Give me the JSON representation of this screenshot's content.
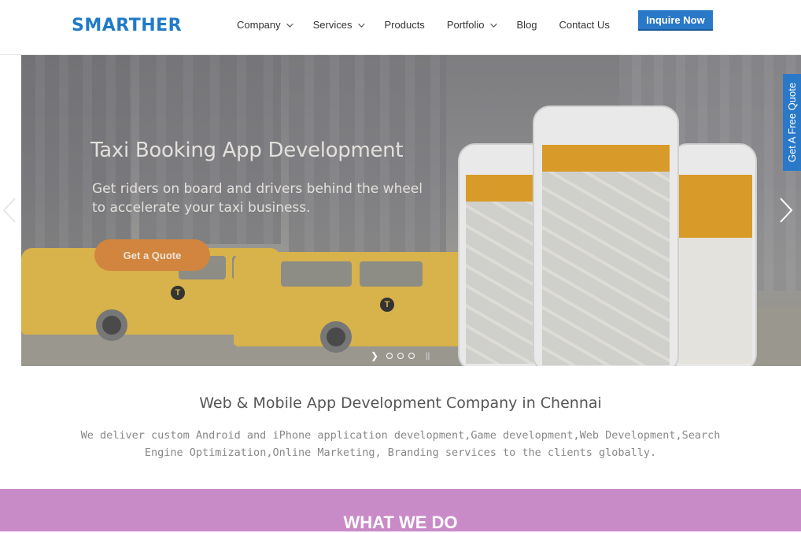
{
  "header": {
    "logo": "SMARTHER",
    "nav": [
      {
        "label": "Company",
        "has_dropdown": true
      },
      {
        "label": "Services",
        "has_dropdown": true
      },
      {
        "label": "Products",
        "has_dropdown": false
      },
      {
        "label": "Portfolio",
        "has_dropdown": true
      },
      {
        "label": "Blog",
        "has_dropdown": false
      },
      {
        "label": "Contact Us",
        "has_dropdown": false
      }
    ],
    "cta": "Inquire Now"
  },
  "hero": {
    "title": "Taxi Booking App Development",
    "subtitle": "Get riders on board and drivers behind the wheel to accelerate your taxi business.",
    "button": "Get a Quote",
    "slide_count": 3
  },
  "side_tab": "Get A Free Quote",
  "intro": {
    "title": "Web & Mobile App Development Company in Chennai",
    "text": "We deliver custom Android and iPhone application development,Game development,Web Development,Search Engine Optimization,Online Marketing, Branding services to the clients globally."
  },
  "section": {
    "title": "WHAT WE DO"
  },
  "colors": {
    "brand": "#1f7ac8",
    "cta": "#2a78c8",
    "hero_button": "#d1853e",
    "band": "#c98bc8"
  },
  "icons": [
    "chevron-down-icon",
    "chevron-left-icon",
    "chevron-right-icon",
    "play-icon",
    "pause-icon"
  ]
}
